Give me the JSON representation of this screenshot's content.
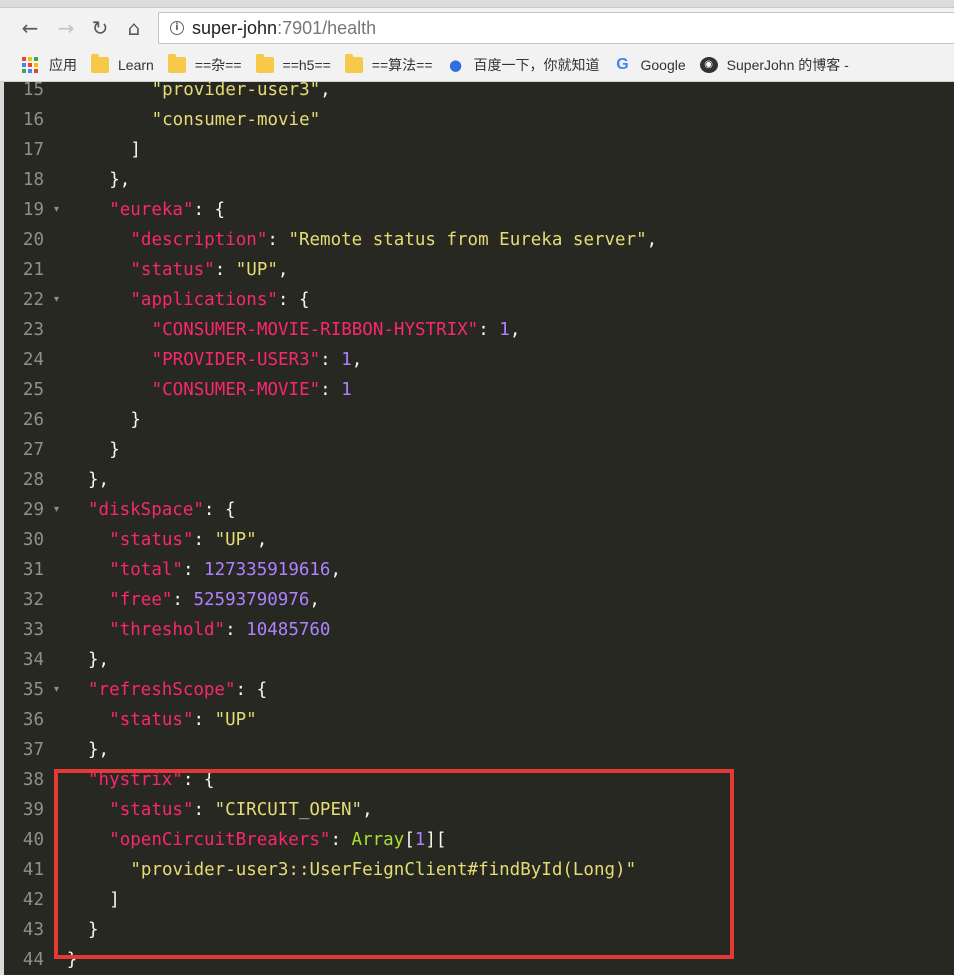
{
  "browser": {
    "url_host": "super-john",
    "url_rest": ":7901/health"
  },
  "bookmarks": [
    {
      "label": "应用",
      "icon": "apps-grid-icon"
    },
    {
      "label": "Learn",
      "icon": "folder-icon"
    },
    {
      "label": "==杂==",
      "icon": "folder-icon"
    },
    {
      "label": "==h5==",
      "icon": "folder-icon"
    },
    {
      "label": "==算法==",
      "icon": "folder-icon"
    },
    {
      "label": "百度一下，你就知道",
      "icon": "baidu-paw-icon"
    },
    {
      "label": "Google",
      "icon": "google-icon"
    },
    {
      "label": "SuperJohn 的博客 -",
      "icon": "github-icon"
    }
  ],
  "colors": {
    "background": "#272822",
    "key": "#f92672",
    "string": "#e6db74",
    "number": "#ae81ff",
    "punctuation": "#f8f8f2",
    "type": "#a6e22e",
    "highlight_box": "#e53935"
  },
  "json_lines": [
    {
      "n": "15",
      "fold": false,
      "indent": 7,
      "parts": [
        {
          "t": "s",
          "v": "\"provider-user3\""
        },
        {
          "t": "p",
          "v": ","
        }
      ]
    },
    {
      "n": "16",
      "fold": false,
      "indent": 7,
      "parts": [
        {
          "t": "s",
          "v": "\"consumer-movie\""
        }
      ]
    },
    {
      "n": "17",
      "fold": false,
      "indent": 6,
      "parts": [
        {
          "t": "p",
          "v": "]"
        }
      ]
    },
    {
      "n": "18",
      "fold": false,
      "indent": 5,
      "parts": [
        {
          "t": "p",
          "v": "},"
        }
      ]
    },
    {
      "n": "19",
      "fold": true,
      "indent": 5,
      "parts": [
        {
          "t": "k",
          "v": "\"eureka\""
        },
        {
          "t": "p",
          "v": ": {"
        }
      ]
    },
    {
      "n": "20",
      "fold": false,
      "indent": 6,
      "parts": [
        {
          "t": "k",
          "v": "\"description\""
        },
        {
          "t": "p",
          "v": ": "
        },
        {
          "t": "s",
          "v": "\"Remote status from Eureka server\""
        },
        {
          "t": "p",
          "v": ","
        }
      ]
    },
    {
      "n": "21",
      "fold": false,
      "indent": 6,
      "parts": [
        {
          "t": "k",
          "v": "\"status\""
        },
        {
          "t": "p",
          "v": ": "
        },
        {
          "t": "s",
          "v": "\"UP\""
        },
        {
          "t": "p",
          "v": ","
        }
      ]
    },
    {
      "n": "22",
      "fold": true,
      "indent": 6,
      "parts": [
        {
          "t": "k",
          "v": "\"applications\""
        },
        {
          "t": "p",
          "v": ": {"
        }
      ]
    },
    {
      "n": "23",
      "fold": false,
      "indent": 7,
      "parts": [
        {
          "t": "k",
          "v": "\"CONSUMER-MOVIE-RIBBON-HYSTRIX\""
        },
        {
          "t": "p",
          "v": ": "
        },
        {
          "t": "n",
          "v": "1"
        },
        {
          "t": "p",
          "v": ","
        }
      ]
    },
    {
      "n": "24",
      "fold": false,
      "indent": 7,
      "parts": [
        {
          "t": "k",
          "v": "\"PROVIDER-USER3\""
        },
        {
          "t": "p",
          "v": ": "
        },
        {
          "t": "n",
          "v": "1"
        },
        {
          "t": "p",
          "v": ","
        }
      ]
    },
    {
      "n": "25",
      "fold": false,
      "indent": 7,
      "parts": [
        {
          "t": "k",
          "v": "\"CONSUMER-MOVIE\""
        },
        {
          "t": "p",
          "v": ": "
        },
        {
          "t": "n",
          "v": "1"
        }
      ]
    },
    {
      "n": "26",
      "fold": false,
      "indent": 6,
      "parts": [
        {
          "t": "p",
          "v": "}"
        }
      ]
    },
    {
      "n": "27",
      "fold": false,
      "indent": 5,
      "parts": [
        {
          "t": "p",
          "v": "}"
        }
      ]
    },
    {
      "n": "28",
      "fold": false,
      "indent": 4,
      "parts": [
        {
          "t": "p",
          "v": "},"
        }
      ]
    },
    {
      "n": "29",
      "fold": true,
      "indent": 4,
      "parts": [
        {
          "t": "k",
          "v": "\"diskSpace\""
        },
        {
          "t": "p",
          "v": ": {"
        }
      ]
    },
    {
      "n": "30",
      "fold": false,
      "indent": 5,
      "parts": [
        {
          "t": "k",
          "v": "\"status\""
        },
        {
          "t": "p",
          "v": ": "
        },
        {
          "t": "s",
          "v": "\"UP\""
        },
        {
          "t": "p",
          "v": ","
        }
      ]
    },
    {
      "n": "31",
      "fold": false,
      "indent": 5,
      "parts": [
        {
          "t": "k",
          "v": "\"total\""
        },
        {
          "t": "p",
          "v": ": "
        },
        {
          "t": "n",
          "v": "127335919616"
        },
        {
          "t": "p",
          "v": ","
        }
      ]
    },
    {
      "n": "32",
      "fold": false,
      "indent": 5,
      "parts": [
        {
          "t": "k",
          "v": "\"free\""
        },
        {
          "t": "p",
          "v": ": "
        },
        {
          "t": "n",
          "v": "52593790976"
        },
        {
          "t": "p",
          "v": ","
        }
      ]
    },
    {
      "n": "33",
      "fold": false,
      "indent": 5,
      "parts": [
        {
          "t": "k",
          "v": "\"threshold\""
        },
        {
          "t": "p",
          "v": ": "
        },
        {
          "t": "n",
          "v": "10485760"
        }
      ]
    },
    {
      "n": "34",
      "fold": false,
      "indent": 4,
      "parts": [
        {
          "t": "p",
          "v": "},"
        }
      ]
    },
    {
      "n": "35",
      "fold": true,
      "indent": 4,
      "parts": [
        {
          "t": "k",
          "v": "\"refreshScope\""
        },
        {
          "t": "p",
          "v": ": {"
        }
      ]
    },
    {
      "n": "36",
      "fold": false,
      "indent": 5,
      "parts": [
        {
          "t": "k",
          "v": "\"status\""
        },
        {
          "t": "p",
          "v": ": "
        },
        {
          "t": "s",
          "v": "\"UP\""
        }
      ]
    },
    {
      "n": "37",
      "fold": false,
      "indent": 4,
      "parts": [
        {
          "t": "p",
          "v": "},"
        }
      ]
    },
    {
      "n": "38",
      "fold": false,
      "indent": 4,
      "parts": [
        {
          "t": "k",
          "v": "\"hystrix\""
        },
        {
          "t": "p",
          "v": ": {"
        }
      ]
    },
    {
      "n": "39",
      "fold": false,
      "indent": 5,
      "parts": [
        {
          "t": "k",
          "v": "\"status\""
        },
        {
          "t": "p",
          "v": ": "
        },
        {
          "t": "s",
          "v": "\"CIRCUIT_OPEN\""
        },
        {
          "t": "p",
          "v": ","
        }
      ]
    },
    {
      "n": "40",
      "fold": false,
      "indent": 5,
      "parts": [
        {
          "t": "k",
          "v": "\"openCircuitBreakers\""
        },
        {
          "t": "p",
          "v": ": "
        },
        {
          "t": "t",
          "v": "Array"
        },
        {
          "t": "p",
          "v": "["
        },
        {
          "t": "n",
          "v": "1"
        },
        {
          "t": "p",
          "v": "]["
        }
      ]
    },
    {
      "n": "41",
      "fold": false,
      "indent": 6,
      "parts": [
        {
          "t": "s",
          "v": "\"provider-user3::UserFeignClient#findById(Long)\""
        }
      ]
    },
    {
      "n": "42",
      "fold": false,
      "indent": 5,
      "parts": [
        {
          "t": "p",
          "v": "]"
        }
      ]
    },
    {
      "n": "43",
      "fold": false,
      "indent": 4,
      "parts": [
        {
          "t": "p",
          "v": "}"
        }
      ]
    },
    {
      "n": "44",
      "fold": false,
      "indent": 3,
      "parts": [
        {
          "t": "p",
          "v": "}"
        }
      ]
    }
  ]
}
